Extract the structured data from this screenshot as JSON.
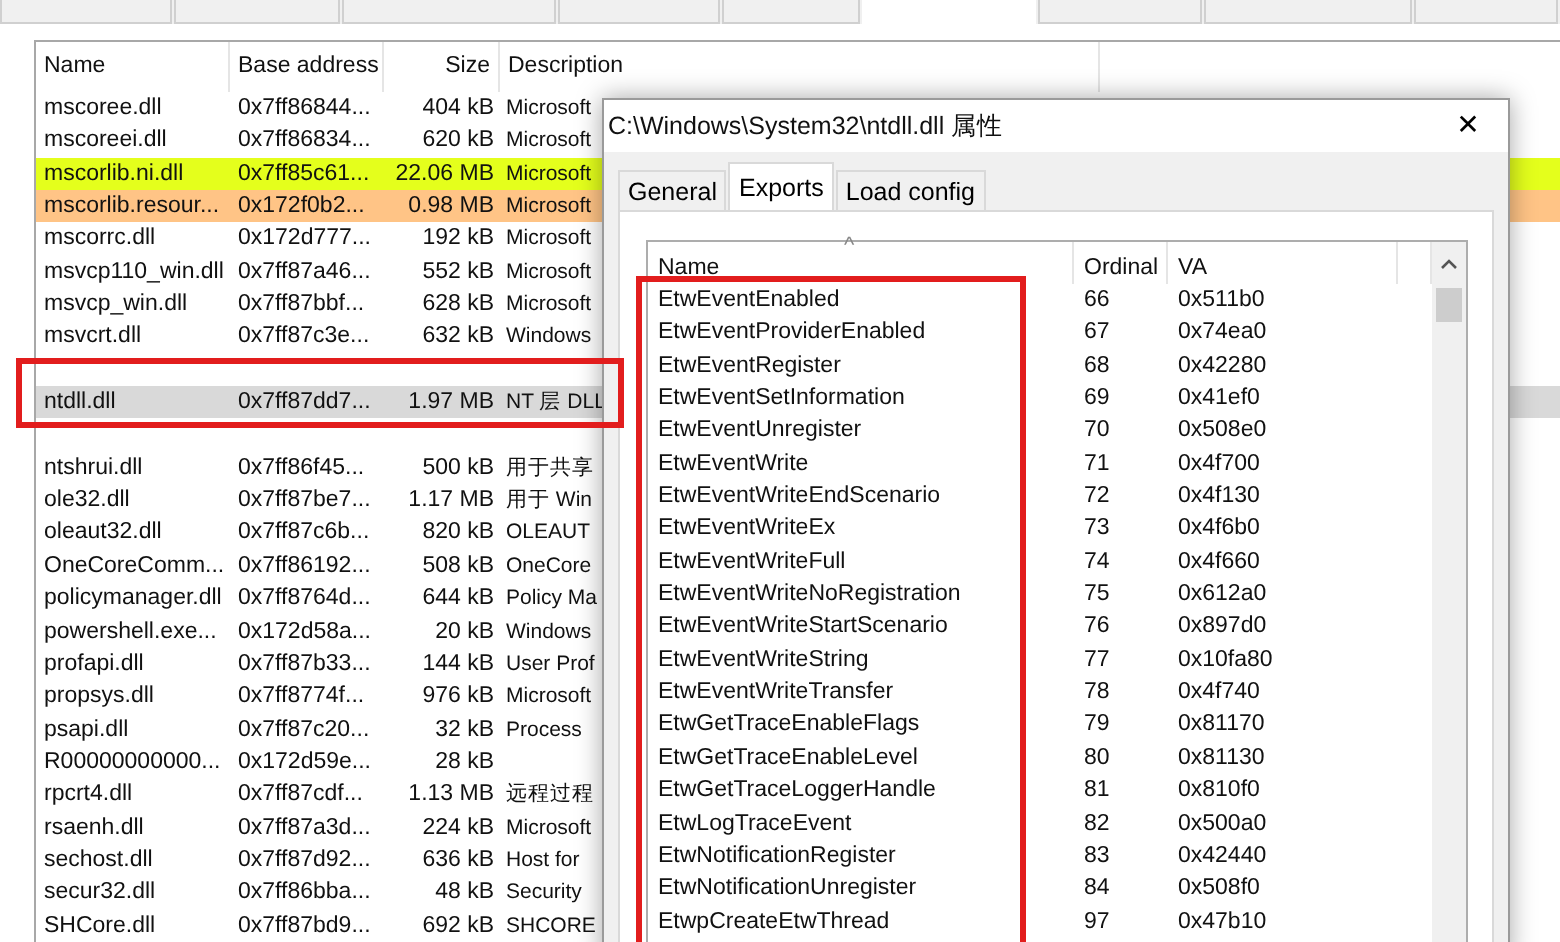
{
  "top_tabs": [
    {
      "selected": false
    },
    {
      "selected": false
    },
    {
      "selected": false
    },
    {
      "selected": false
    },
    {
      "selected": false
    },
    {
      "selected": true
    },
    {
      "selected": false
    },
    {
      "selected": false
    },
    {
      "selected": false
    }
  ],
  "modules": {
    "columns": [
      "Name",
      "Base address",
      "Size",
      "Description"
    ],
    "rows": [
      {
        "kind": "row",
        "name": "mscoree.dll",
        "base_address": "0x7ff86844...",
        "size": "404 kB",
        "description": "Microsoft",
        "selected": false
      },
      {
        "kind": "row",
        "name": "mscoreei.dll",
        "base_address": "0x7ff86834...",
        "size": "620 kB",
        "description": "Microsoft",
        "selected": false
      },
      {
        "kind": "row",
        "name": "mscorlib.ni.dll",
        "base_address": "0x7ff85c61...",
        "size": "22.06 MB",
        "description": "Microsoft",
        "selected": false,
        "color": "#e4ff1c"
      },
      {
        "kind": "row",
        "name": "mscorlib.resour...",
        "base_address": "0x172f0b2...",
        "size": "0.98 MB",
        "description": "Microsoft",
        "selected": false,
        "color": "#ffc486"
      },
      {
        "kind": "row",
        "name": "mscorrc.dll",
        "base_address": "0x172d777...",
        "size": "192 kB",
        "description": "Microsoft",
        "selected": false
      },
      {
        "kind": "row",
        "name": "msvcp110_win.dll",
        "base_address": "0x7ff87a46...",
        "size": "552 kB",
        "description": "Microsoft",
        "selected": false
      },
      {
        "kind": "row",
        "name": "msvcp_win.dll",
        "base_address": "0x7ff87bbf...",
        "size": "628 kB",
        "description": "Microsoft",
        "selected": false
      },
      {
        "kind": "row",
        "name": "msvcrt.dll",
        "base_address": "0x7ff87c3e...",
        "size": "632 kB",
        "description": "Windows",
        "selected": false
      },
      {
        "kind": "obscured"
      },
      {
        "kind": "row",
        "name": "ntdll.dll",
        "base_address": "0x7ff87dd7...",
        "size": "1.97 MB",
        "description": "NT 层 DLL",
        "selected": true
      },
      {
        "kind": "obscured"
      },
      {
        "kind": "row",
        "name": "ntshrui.dll",
        "base_address": "0x7ff86f45...",
        "size": "500 kB",
        "description": "用于共享",
        "selected": false
      },
      {
        "kind": "row",
        "name": "ole32.dll",
        "base_address": "0x7ff87be7...",
        "size": "1.17 MB",
        "description": "用于 Win",
        "selected": false
      },
      {
        "kind": "row",
        "name": "oleaut32.dll",
        "base_address": "0x7ff87c6b...",
        "size": "820 kB",
        "description": "OLEAUT",
        "selected": false
      },
      {
        "kind": "row",
        "name": "OneCoreComm...",
        "base_address": "0x7ff86192...",
        "size": "508 kB",
        "description": "OneCore",
        "selected": false
      },
      {
        "kind": "row",
        "name": "policymanager.dll",
        "base_address": "0x7ff8764d...",
        "size": "644 kB",
        "description": "Policy Ma",
        "selected": false
      },
      {
        "kind": "row",
        "name": "powershell.exe...",
        "base_address": "0x172d58a...",
        "size": "20 kB",
        "description": "Windows",
        "selected": false
      },
      {
        "kind": "row",
        "name": "profapi.dll",
        "base_address": "0x7ff87b33...",
        "size": "144 kB",
        "description": "User Prof",
        "selected": false
      },
      {
        "kind": "row",
        "name": "propsys.dll",
        "base_address": "0x7ff8774f...",
        "size": "976 kB",
        "description": "Microsoft",
        "selected": false
      },
      {
        "kind": "row",
        "name": "psapi.dll",
        "base_address": "0x7ff87c20...",
        "size": "32 kB",
        "description": "Process",
        "selected": false
      },
      {
        "kind": "row",
        "name": "R00000000000...",
        "base_address": "0x172d59e...",
        "size": "28 kB",
        "selected": false
      },
      {
        "kind": "row",
        "name": "rpcrt4.dll",
        "base_address": "0x7ff87cdf...",
        "size": "1.13 MB",
        "description": "远程过程",
        "selected": false
      },
      {
        "kind": "row",
        "name": "rsaenh.dll",
        "base_address": "0x7ff87a3d...",
        "size": "224 kB",
        "description": "Microsoft",
        "selected": false
      },
      {
        "kind": "row",
        "name": "sechost.dll",
        "base_address": "0x7ff87d92...",
        "size": "636 kB",
        "description": "Host for",
        "selected": false
      },
      {
        "kind": "row",
        "name": "secur32.dll",
        "base_address": "0x7ff86bba...",
        "size": "48 kB",
        "description": "Security",
        "selected": false
      },
      {
        "kind": "row",
        "name": "SHCore.dll",
        "base_address": "0x7ff87bd9...",
        "size": "692 kB",
        "description": "SHCORE",
        "selected": false
      }
    ]
  },
  "dialog": {
    "title": "C:\\Windows\\System32\\ntdll.dll 属性",
    "close": "✕",
    "tabs": [
      {
        "label": "General",
        "selected": false
      },
      {
        "label": "Exports",
        "selected": true
      },
      {
        "label": "Load config",
        "selected": false
      }
    ],
    "exports": {
      "sort_caret": "^",
      "columns": [
        "Name",
        "Ordinal",
        "VA"
      ],
      "rows": [
        {
          "name": "EtwEventEnabled",
          "ordinal": "66",
          "va": "0x511b0"
        },
        {
          "name": "EtwEventProviderEnabled",
          "ordinal": "67",
          "va": "0x74ea0"
        },
        {
          "name": "EtwEventRegister",
          "ordinal": "68",
          "va": "0x42280"
        },
        {
          "name": "EtwEventSetInformation",
          "ordinal": "69",
          "va": "0x41ef0"
        },
        {
          "name": "EtwEventUnregister",
          "ordinal": "70",
          "va": "0x508e0"
        },
        {
          "name": "EtwEventWrite",
          "ordinal": "71",
          "va": "0x4f700"
        },
        {
          "name": "EtwEventWriteEndScenario",
          "ordinal": "72",
          "va": "0x4f130"
        },
        {
          "name": "EtwEventWriteEx",
          "ordinal": "73",
          "va": "0x4f6b0"
        },
        {
          "name": "EtwEventWriteFull",
          "ordinal": "74",
          "va": "0x4f660"
        },
        {
          "name": "EtwEventWriteNoRegistration",
          "ordinal": "75",
          "va": "0x612a0"
        },
        {
          "name": "EtwEventWriteStartScenario",
          "ordinal": "76",
          "va": "0x897d0"
        },
        {
          "name": "EtwEventWriteString",
          "ordinal": "77",
          "va": "0x10fa80"
        },
        {
          "name": "EtwEventWriteTransfer",
          "ordinal": "78",
          "va": "0x4f740"
        },
        {
          "name": "EtwGetTraceEnableFlags",
          "ordinal": "79",
          "va": "0x81170"
        },
        {
          "name": "EtwGetTraceEnableLevel",
          "ordinal": "80",
          "va": "0x81130"
        },
        {
          "name": "EtwGetTraceLoggerHandle",
          "ordinal": "81",
          "va": "0x810f0"
        },
        {
          "name": "EtwLogTraceEvent",
          "ordinal": "82",
          "va": "0x500a0"
        },
        {
          "name": "EtwNotificationRegister",
          "ordinal": "83",
          "va": "0x42440"
        },
        {
          "name": "EtwNotificationUnregister",
          "ordinal": "84",
          "va": "0x508f0"
        },
        {
          "name": "EtwpCreateEtwThread",
          "ordinal": "97",
          "va": "0x47b10"
        }
      ]
    }
  }
}
